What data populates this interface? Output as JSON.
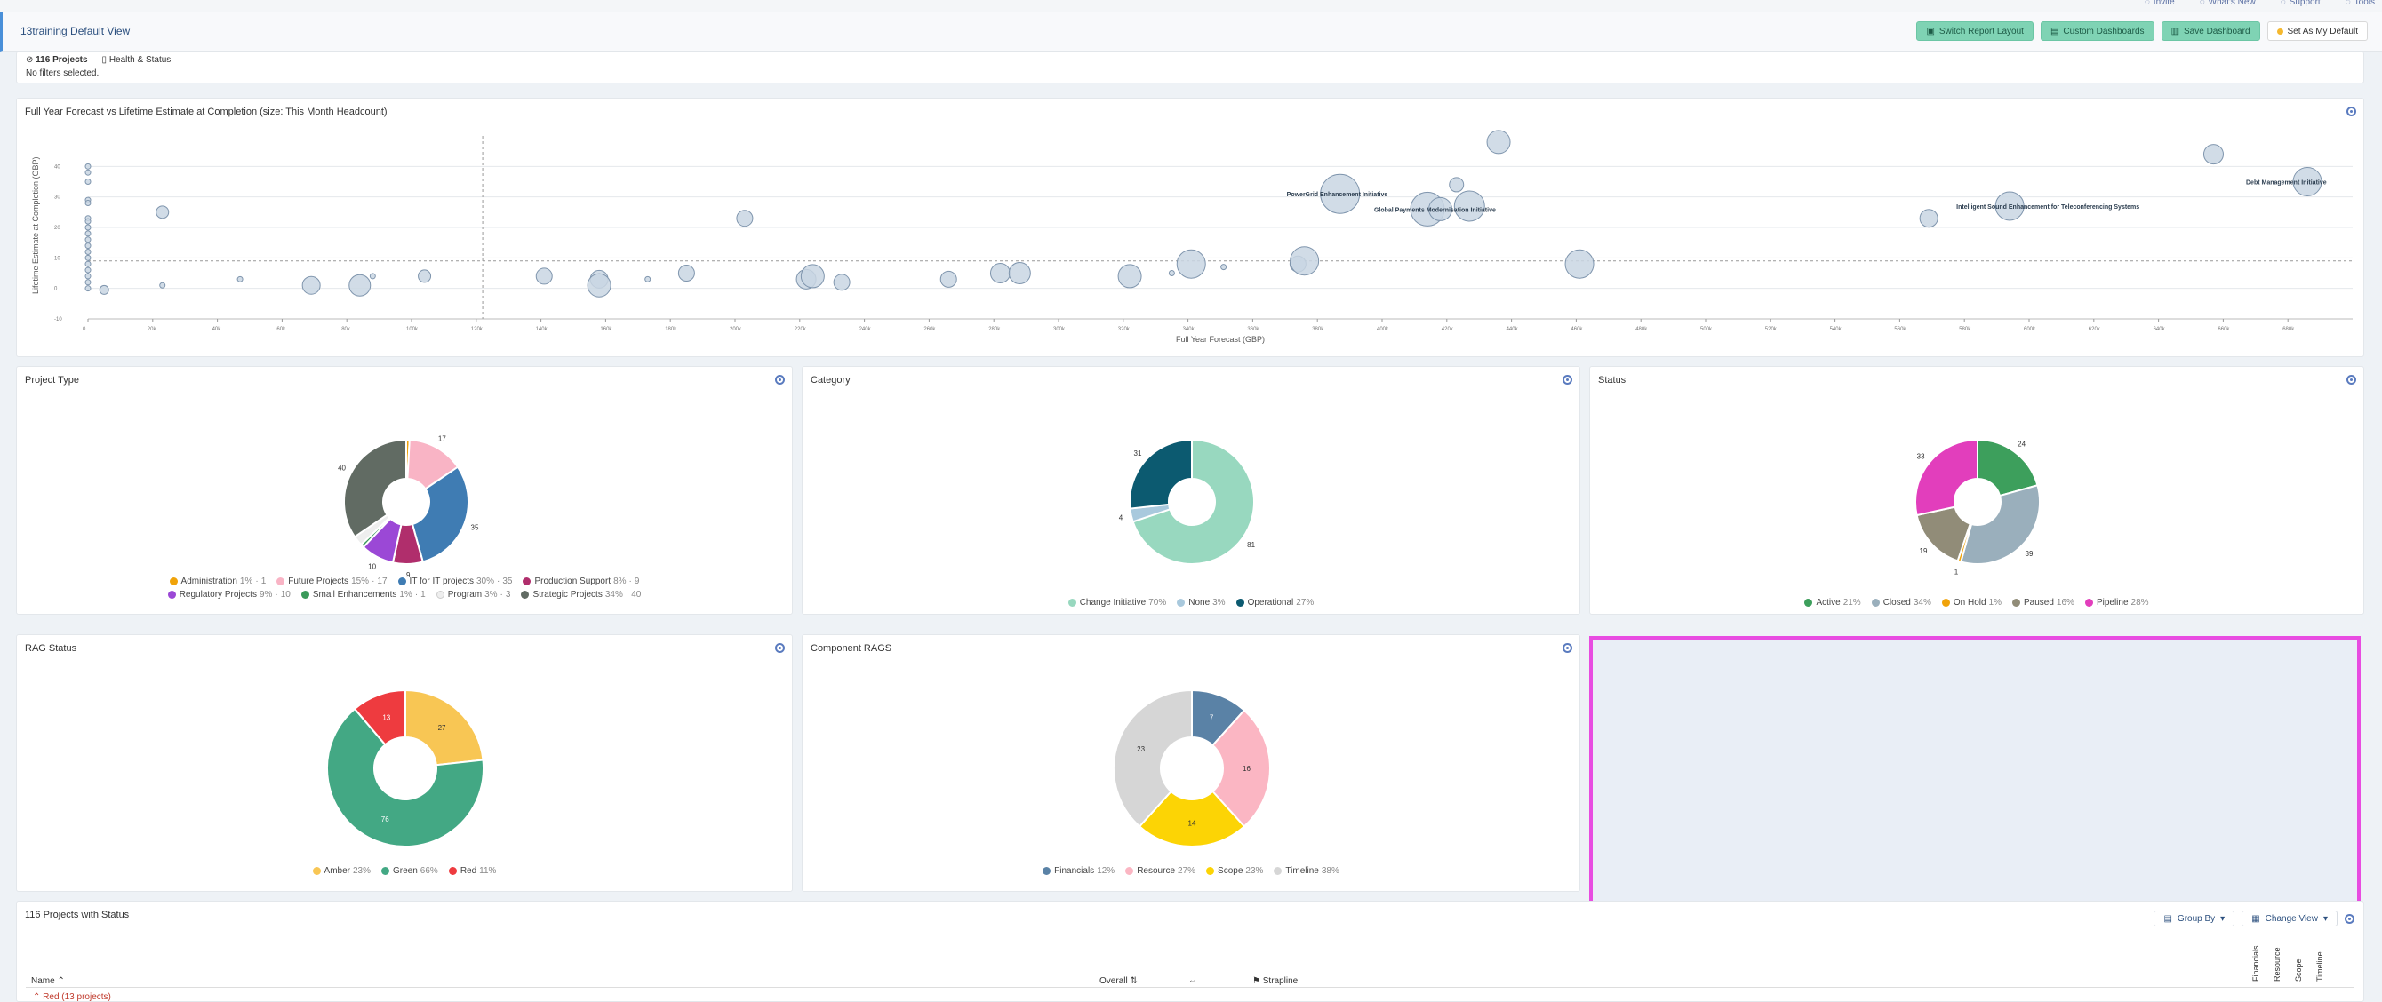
{
  "toplinks": [
    {
      "label": "Invite",
      "icon": "user-plus-icon"
    },
    {
      "label": "What's New",
      "icon": "gift-icon"
    },
    {
      "label": "Support",
      "icon": "question-icon"
    },
    {
      "label": "Tools",
      "icon": "gear-icon"
    }
  ],
  "header": {
    "title": "13training Default View",
    "buttons": [
      "Switch Report Layout",
      "Custom Dashboards",
      "Save Dashboard",
      "Set As My Default"
    ]
  },
  "filters": {
    "projects": "116 Projects",
    "view": "Health & Status",
    "none": "No filters selected."
  },
  "scatter": {
    "title": "Full Year Forecast vs Lifetime Estimate at Completion (size: This Month Headcount)",
    "chart_data": {
      "type": "scatter",
      "title": "Full Year Forecast vs Lifetime Estimate at Completion (size: This Month Headcount)",
      "xlabel": "Full Year Forecast (GBP)",
      "ylabel": "Lifetime Estimate at Completion (GBP)",
      "xlim": [
        0,
        700
      ],
      "ylim": [
        -10,
        50
      ],
      "points": [
        {
          "x": 0,
          "y": 40,
          "r": 3
        },
        {
          "x": 0,
          "y": 38,
          "r": 3
        },
        {
          "x": 0,
          "y": 35,
          "r": 3
        },
        {
          "x": 0,
          "y": 29,
          "r": 3
        },
        {
          "x": 0,
          "y": 28,
          "r": 3
        },
        {
          "x": 0,
          "y": 23,
          "r": 3
        },
        {
          "x": 0,
          "y": 22,
          "r": 3
        },
        {
          "x": 0,
          "y": 20,
          "r": 3
        },
        {
          "x": 0,
          "y": 18,
          "r": 3
        },
        {
          "x": 0,
          "y": 16,
          "r": 3
        },
        {
          "x": 0,
          "y": 14,
          "r": 3
        },
        {
          "x": 0,
          "y": 12,
          "r": 3
        },
        {
          "x": 0,
          "y": 10,
          "r": 3
        },
        {
          "x": 0,
          "y": 8,
          "r": 3
        },
        {
          "x": 0,
          "y": 6,
          "r": 3
        },
        {
          "x": 0,
          "y": 4,
          "r": 3
        },
        {
          "x": 0,
          "y": 2,
          "r": 3
        },
        {
          "x": 0,
          "y": 0,
          "r": 3
        },
        {
          "x": 5,
          "y": -0.5,
          "r": 5
        },
        {
          "x": 23,
          "y": 25,
          "r": 7
        },
        {
          "x": 23,
          "y": 1,
          "r": 3
        },
        {
          "x": 47,
          "y": 3,
          "r": 3
        },
        {
          "x": 69,
          "y": 1,
          "r": 10
        },
        {
          "x": 84,
          "y": 1,
          "r": 12
        },
        {
          "x": 88,
          "y": 4,
          "r": 3
        },
        {
          "x": 104,
          "y": 4,
          "r": 7
        },
        {
          "x": 141,
          "y": 4,
          "r": 9
        },
        {
          "x": 158,
          "y": 3,
          "r": 10
        },
        {
          "x": 158,
          "y": 1,
          "r": 13
        },
        {
          "x": 173,
          "y": 3,
          "r": 3
        },
        {
          "x": 185,
          "y": 5,
          "r": 9
        },
        {
          "x": 203,
          "y": 23,
          "r": 9
        },
        {
          "x": 222,
          "y": 3,
          "r": 11
        },
        {
          "x": 224,
          "y": 4,
          "r": 13
        },
        {
          "x": 233,
          "y": 2,
          "r": 9
        },
        {
          "x": 266,
          "y": 3,
          "r": 9
        },
        {
          "x": 282,
          "y": 5,
          "r": 11
        },
        {
          "x": 288,
          "y": 5,
          "r": 12
        },
        {
          "x": 322,
          "y": 4,
          "r": 13
        },
        {
          "x": 335,
          "y": 5,
          "r": 3
        },
        {
          "x": 341,
          "y": 8,
          "r": 16
        },
        {
          "x": 351,
          "y": 7,
          "r": 3
        },
        {
          "x": 374,
          "y": 8,
          "r": 9
        },
        {
          "x": 376,
          "y": 9,
          "r": 16
        },
        {
          "x": 387,
          "y": 31,
          "r": 22
        },
        {
          "x": 414,
          "y": 26,
          "r": 19
        },
        {
          "x": 418,
          "y": 26,
          "r": 13
        },
        {
          "x": 423,
          "y": 34,
          "r": 8
        },
        {
          "x": 427,
          "y": 27,
          "r": 17
        },
        {
          "x": 436,
          "y": 48,
          "r": 13
        },
        {
          "x": 461,
          "y": 8,
          "r": 16
        },
        {
          "x": 569,
          "y": 23,
          "r": 10
        },
        {
          "x": 594,
          "y": 27,
          "r": 16
        },
        {
          "x": 657,
          "y": 44,
          "r": 11
        },
        {
          "x": 686,
          "y": 35,
          "r": 16
        }
      ],
      "annotations": [
        {
          "text": "PowerGrid Enhancement Initiative",
          "x": 387,
          "y": 31
        },
        {
          "text": "Global Payments Modernisation Initiative",
          "x": 414,
          "y": 26
        },
        {
          "text": "Intelligent Sound Enhancement for Teleconferencing Systems",
          "x": 594,
          "y": 27
        },
        {
          "text": "Debt Management Initiative",
          "x": 686,
          "y": 35
        }
      ],
      "ref_lines": {
        "x": 122,
        "y": 9
      },
      "yticks": [
        -10,
        0,
        10,
        20,
        30,
        40
      ],
      "ytick_labels": [
        "-10",
        "0",
        "10",
        "20",
        "30",
        "40"
      ],
      "xticks": [
        0,
        20,
        40,
        60,
        80,
        100,
        120,
        140,
        160,
        180,
        200,
        220,
        240,
        260,
        280,
        300,
        320,
        340,
        360,
        380,
        400,
        420,
        440,
        460,
        480,
        500,
        520,
        540,
        560,
        580,
        600,
        620,
        640,
        660,
        680
      ],
      "xtick_labels": [
        "0",
        "20k",
        "40k",
        "60k",
        "80k",
        "100k",
        "120k",
        "140k",
        "160k",
        "180k",
        "200k",
        "220k",
        "240k",
        "260k",
        "280k",
        "300k",
        "320k",
        "340k",
        "360k",
        "380k",
        "400k",
        "420k",
        "440k",
        "460k",
        "480k",
        "500k",
        "520k",
        "540k",
        "560k",
        "580k",
        "600k",
        "620k",
        "640k",
        "660k",
        "680k"
      ],
      "color": "#c9d6e3",
      "stroke": "#7f95ad"
    }
  },
  "donuts": [
    {
      "key": "ptype",
      "title": "Project Type",
      "chart_data": {
        "type": "pie",
        "title": "Project Type",
        "slices": [
          {
            "name": "Administration",
            "value": 1,
            "pct": "1%",
            "count": "1",
            "color": "#f0a30a"
          },
          {
            "name": "Future Projects",
            "value": 17,
            "pct": "15%",
            "count": "17",
            "color": "#f9b4c5"
          },
          {
            "name": "IT for IT projects",
            "value": 35,
            "pct": "30%",
            "count": "35",
            "color": "#3f7cb3"
          },
          {
            "name": "Production Support",
            "value": 9,
            "pct": "8%",
            "count": "9",
            "color": "#b02e6c"
          },
          {
            "name": "Regulatory Projects",
            "value": 10,
            "pct": "9%",
            "count": "10",
            "color": "#9b48d6"
          },
          {
            "name": "Small Enhancements",
            "value": 1,
            "pct": "1%",
            "count": "1",
            "color": "#3a9a5a"
          },
          {
            "name": "Program",
            "value": 3,
            "pct": "3%",
            "count": "3",
            "color": "#eeeeee"
          },
          {
            "name": "Strategic Projects",
            "value": 40,
            "pct": "34%",
            "count": "40",
            "color": "#616b63"
          }
        ],
        "data_labels": [
          "",
          "17",
          "35",
          "9",
          "10",
          "",
          "",
          "40"
        ]
      }
    },
    {
      "key": "category",
      "title": "Category",
      "chart_data": {
        "type": "pie",
        "title": "Category",
        "slices": [
          {
            "name": "Change Initiative",
            "value": 81,
            "pct": "70%",
            "color": "#98d8bf"
          },
          {
            "name": "None",
            "value": 4,
            "pct": "3%",
            "color": "#a9c9dd"
          },
          {
            "name": "Operational",
            "value": 31,
            "pct": "27%",
            "color": "#0c5a70"
          }
        ],
        "data_labels": [
          "81",
          "4",
          "31"
        ]
      }
    },
    {
      "key": "status",
      "title": "Status",
      "chart_data": {
        "type": "pie",
        "title": "Status",
        "slices": [
          {
            "name": "Active",
            "value": 24,
            "pct": "21%",
            "color": "#3d9f5c"
          },
          {
            "name": "Closed",
            "value": 39,
            "pct": "34%",
            "color": "#9aafbc"
          },
          {
            "name": "On Hold",
            "value": 1,
            "pct": "1%",
            "color": "#f0a30a"
          },
          {
            "name": "Paused",
            "value": 19,
            "pct": "16%",
            "color": "#918c78"
          },
          {
            "name": "Pipeline",
            "value": 33,
            "pct": "28%",
            "color": "#e23ebc"
          }
        ],
        "data_labels": [
          "24",
          "39",
          "1",
          "19",
          "33"
        ]
      }
    },
    {
      "key": "rag",
      "title": "RAG Status",
      "chart_data": {
        "type": "pie",
        "title": "RAG Status",
        "slices": [
          {
            "name": "Amber",
            "value": 27,
            "pct": "23%",
            "color": "#f8c654"
          },
          {
            "name": "Green",
            "value": 76,
            "pct": "66%",
            "color": "#43a884"
          },
          {
            "name": "Red",
            "value": 13,
            "pct": "11%",
            "color": "#ee3b3f"
          }
        ],
        "data_labels": [
          "27",
          "76",
          "13"
        ]
      }
    },
    {
      "key": "comp",
      "title": "Component RAGS",
      "chart_data": {
        "type": "pie",
        "title": "Component RAGS",
        "slices": [
          {
            "name": "Financials",
            "value": 7,
            "pct": "12%",
            "color": "#5a82a6"
          },
          {
            "name": "Resource",
            "value": 16,
            "pct": "27%",
            "color": "#fbb6c3"
          },
          {
            "name": "Scope",
            "value": 14,
            "pct": "23%",
            "color": "#fcd405"
          },
          {
            "name": "Timeline",
            "value": 23,
            "pct": "38%",
            "color": "#d6d6d6"
          }
        ],
        "data_labels": [
          "7",
          "16",
          "14",
          "23"
        ]
      }
    }
  ],
  "table": {
    "title": "116 Projects with Status",
    "group_by": "Group By",
    "change_view": "Change View",
    "col_name": "Name",
    "col_overall": "Overall",
    "col_strapline": "Strapline",
    "vertical_cols": [
      "Financials",
      "Resource",
      "Scope",
      "Timeline"
    ],
    "group_row": "Red (13 projects)"
  }
}
